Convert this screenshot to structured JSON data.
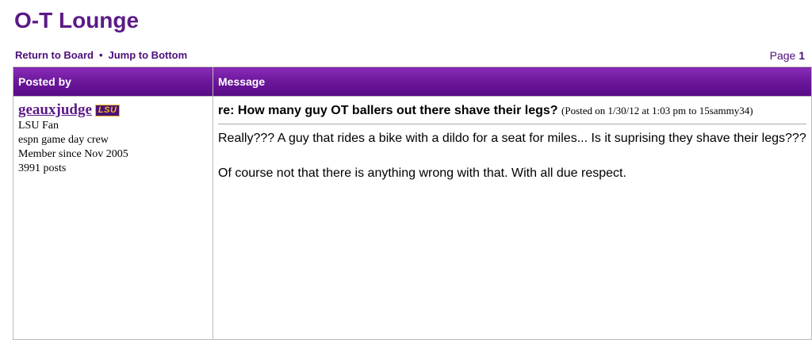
{
  "board": {
    "title": "O-T Lounge"
  },
  "nav": {
    "return_label": "Return to Board",
    "separator": "•",
    "jump_label": "Jump to Bottom"
  },
  "pagination": {
    "prefix": "Page",
    "current": "1"
  },
  "table": {
    "col_author": "Posted by",
    "col_message": "Message"
  },
  "post": {
    "author": {
      "username": "geauxjudge",
      "team_logo": "LSU",
      "team": "LSU Fan",
      "title": "espn game day crew",
      "member_since": "Member since Nov 2005",
      "posts": "3991 posts"
    },
    "subject": "re: How many guy OT ballers out there shave their legs?",
    "posted_info": "(Posted on 1/30/12 at 1:03 pm to 15sammy34)",
    "body": [
      "Really??? A guy that rides a bike with a dildo for a seat for miles... Is it suprising they shave their legs???",
      "Of course not that there is anything wrong with that. With all due respect."
    ]
  },
  "colors": {
    "brand_purple": "#5b1a87",
    "header_gradient_top": "#8a2bb8",
    "header_gradient_bottom": "#580a86",
    "logo_gold": "#f2b822"
  }
}
